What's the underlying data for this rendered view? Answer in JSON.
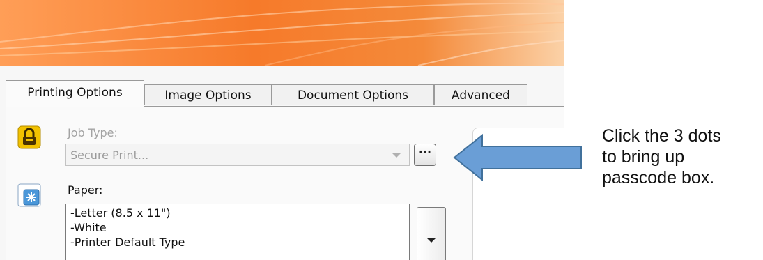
{
  "tabs": [
    {
      "label": "Printing Options",
      "active": true
    },
    {
      "label": "Image Options",
      "active": false
    },
    {
      "label": "Document Options",
      "active": false
    },
    {
      "label": "Advanced",
      "active": false
    }
  ],
  "job_type": {
    "label": "Job Type:",
    "value": "Secure Print...",
    "enabled": false,
    "more_button_label": "···",
    "icon": "lock-icon"
  },
  "paper": {
    "label": "Paper:",
    "summary_lines": [
      "-Letter (8.5 x 11\")",
      "-White",
      "-Printer Default Type"
    ],
    "icon": "paper-settings-icon"
  },
  "annotation": {
    "lines": [
      "Click the 3 dots",
      "to bring up",
      "passcode box."
    ],
    "arrow_color": "#6a9ed6",
    "arrow_direction": "left"
  },
  "colors": {
    "banner_accent": "#f67a2a",
    "lock_icon": "#f2c200",
    "paper_icon": "#4a97d9"
  }
}
